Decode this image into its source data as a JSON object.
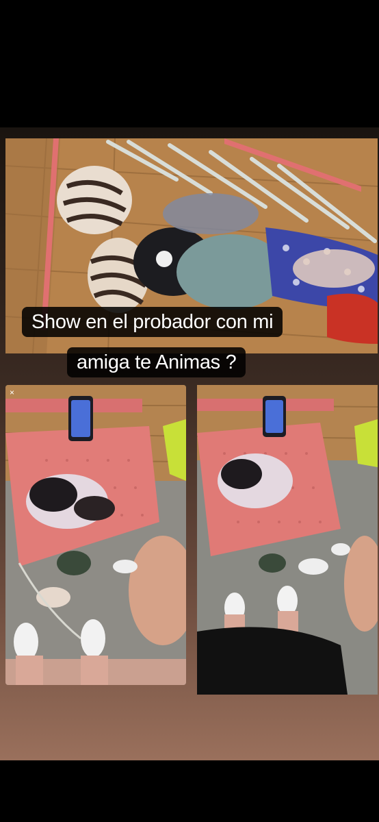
{
  "story": {
    "caption_line1": "Show en el probador con mi",
    "caption_line2": "amiga te Animas ?",
    "close_glyph": "×"
  },
  "photos": [
    {
      "id": "top",
      "subject": "bikinis and bras on hangers over a wooden bench"
    },
    {
      "id": "left",
      "subject": "fitting room floor with pink shelf, phone and white sneakers"
    },
    {
      "id": "right",
      "subject": "fitting room floor with pink shelf, socks and sneakers"
    }
  ],
  "colors": {
    "shelf_pink": "#e27a78",
    "wood": "#b8864e",
    "floor": "#8c8c88",
    "caption_bg": "#000000"
  }
}
